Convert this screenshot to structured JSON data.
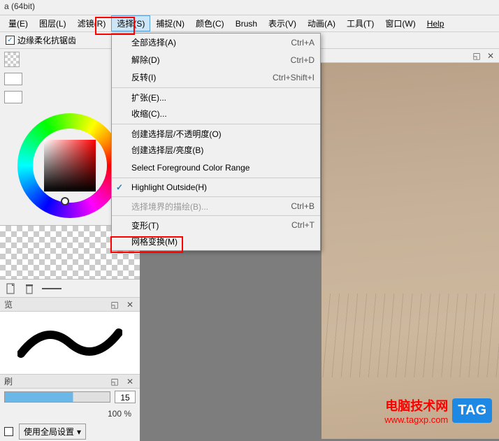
{
  "title": "a (64bit)",
  "menu": [
    {
      "label": "量(E)",
      "ul": "E"
    },
    {
      "label": "图层(L)",
      "ul": "L"
    },
    {
      "label": "滤镜(R)",
      "ul": "R"
    },
    {
      "label": "选择(S)",
      "ul": "S",
      "active": true
    },
    {
      "label": "捕捉(N)",
      "ul": "N"
    },
    {
      "label": "颜色(C)",
      "ul": "C"
    },
    {
      "label": "Brush",
      "ul": ""
    },
    {
      "label": "表示(V)",
      "ul": "V"
    },
    {
      "label": "动画(A)",
      "ul": "A"
    },
    {
      "label": "工具(T)",
      "ul": "T"
    },
    {
      "label": "窗口(W)",
      "ul": "W"
    },
    {
      "label": "Help",
      "ul": "H"
    }
  ],
  "option_checkbox": "边缘柔化抗锯齿",
  "dropdown": [
    {
      "label": "全部选择(A)",
      "shortcut": "Ctrl+A"
    },
    {
      "label": "解除(D)",
      "shortcut": "Ctrl+D"
    },
    {
      "label": "反转(I)",
      "shortcut": "Ctrl+Shift+I"
    },
    {
      "label": "扩张(E)...",
      "sep": true
    },
    {
      "label": "收缩(C)..."
    },
    {
      "label": "创建选择层/不透明度(O)",
      "sep": true
    },
    {
      "label": "创建选择层/亮度(B)"
    },
    {
      "label": "Select Foreground Color Range"
    },
    {
      "label": "Highlight Outside(H)",
      "checked": true,
      "sep": true
    },
    {
      "label": "选择境界的描绘(B)...",
      "shortcut": "Ctrl+B",
      "sep": true,
      "disabled": true
    },
    {
      "label": "变形(T)",
      "shortcut": "Ctrl+T",
      "sep": true
    },
    {
      "label": "网格变换(M)"
    }
  ],
  "section_preview": "览",
  "section_brush": "刷",
  "slider_value": "15",
  "percent": "100 %",
  "bottom_label": "使用全局设置",
  "watermark": {
    "line1": "电脑技术网",
    "line2": "www.tagxp.com",
    "tag": "TAG"
  }
}
